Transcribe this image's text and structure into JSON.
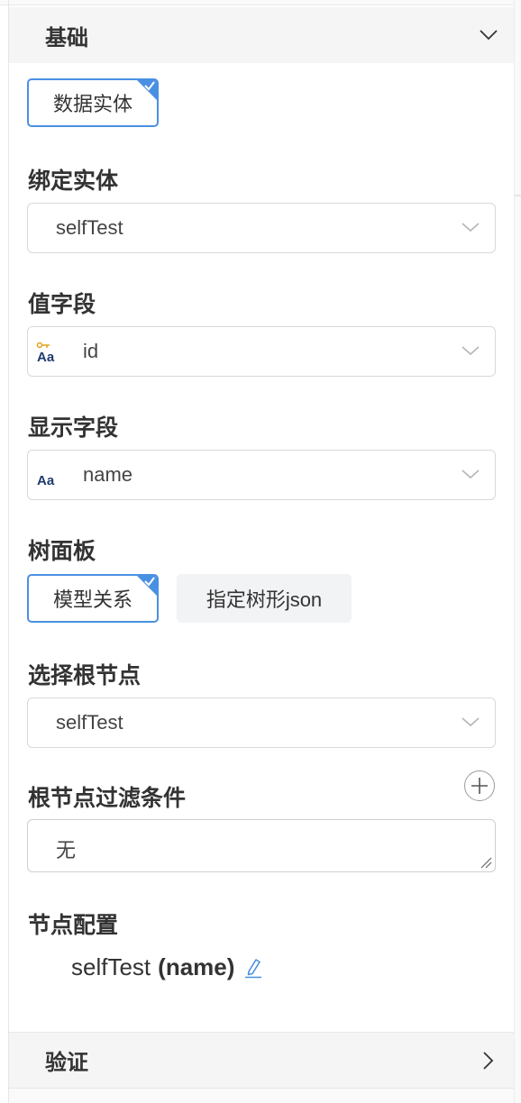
{
  "sections": {
    "basic": {
      "title": "基础"
    },
    "verify": {
      "title": "验证"
    }
  },
  "data_source": {
    "selected_label": "数据实体"
  },
  "bind_entity": {
    "label": "绑定实体",
    "value": "selfTest"
  },
  "value_field": {
    "label": "值字段",
    "value": "id",
    "icon": "key-text-type-icon"
  },
  "display_field": {
    "label": "显示字段",
    "value": "name",
    "icon": "text-type-icon"
  },
  "tree_panel": {
    "label": "树面板",
    "options": [
      {
        "label": "模型关系",
        "selected": true
      },
      {
        "label": "指定树形json",
        "selected": false
      }
    ]
  },
  "root_node": {
    "label": "选择根节点",
    "value": "selfTest"
  },
  "root_filter": {
    "label": "根节点过滤条件",
    "value": "无"
  },
  "node_config": {
    "label": "节点配置",
    "entity": "selfTest",
    "field": "(name)"
  },
  "colors": {
    "accent": "#4a90e2",
    "header_bg": "#f5f5f5",
    "border": "#d9d9d9"
  }
}
